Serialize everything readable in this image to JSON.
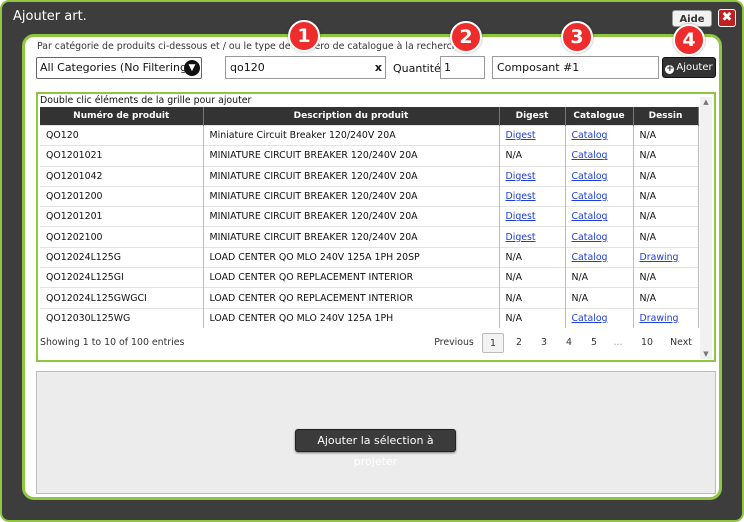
{
  "window": {
    "title": "Ajouter art.",
    "help_label": "Aide",
    "close_label": "✖"
  },
  "instruction": "Par catégorie de produits ci-dessous et / ou le type de numéro de catalogue à la recherche",
  "badges": [
    "1",
    "2",
    "3",
    "4"
  ],
  "colors": {
    "accent": "#8ec63f",
    "badge": "#ee2c2c",
    "dark": "#3d3d3d",
    "link": "#1f3fdd"
  },
  "filters": {
    "category": {
      "selected": "All Categories (No Filtering)"
    },
    "search": {
      "value": "qo120",
      "clear_label": "x"
    },
    "quantity": {
      "label": "Quantité:",
      "value": "1"
    },
    "component": {
      "value": "Composant #1"
    },
    "add_label": "Ajouter"
  },
  "grid": {
    "caption": "Double clic éléments de la grille pour ajouter",
    "columns": [
      "Numéro de produit",
      "Description du produit",
      "Digest",
      "Catalogue",
      "Dessin"
    ],
    "rows": [
      {
        "product": "QO120",
        "description": "Miniature Circuit Breaker 120/240V 20A",
        "digest": "Digest",
        "catalog": "Catalog",
        "drawing": "N/A"
      },
      {
        "product": "QO1201021",
        "description": "MINIATURE CIRCUIT BREAKER 120/240V 20A",
        "digest": "N/A",
        "catalog": "Catalog",
        "drawing": "N/A"
      },
      {
        "product": "QO1201042",
        "description": "MINIATURE CIRCUIT BREAKER 120/240V 20A",
        "digest": "Digest",
        "catalog": "Catalog",
        "drawing": "N/A"
      },
      {
        "product": "QO1201200",
        "description": "MINIATURE CIRCUIT BREAKER 120/240V 20A",
        "digest": "Digest",
        "catalog": "Catalog",
        "drawing": "N/A"
      },
      {
        "product": "QO1201201",
        "description": "MINIATURE CIRCUIT BREAKER 120/240V 20A",
        "digest": "Digest",
        "catalog": "Catalog",
        "drawing": "N/A"
      },
      {
        "product": "QO1202100",
        "description": "MINIATURE CIRCUIT BREAKER 120/240V 20A",
        "digest": "Digest",
        "catalog": "Catalog",
        "drawing": "N/A"
      },
      {
        "product": "QO12024L125G",
        "description": "LOAD CENTER QO MLO 240V 125A 1PH 20SP",
        "digest": "N/A",
        "catalog": "Catalog",
        "drawing": "Drawing"
      },
      {
        "product": "QO12024L125GI",
        "description": "LOAD CENTER QO REPLACEMENT INTERIOR",
        "digest": "N/A",
        "catalog": "N/A",
        "drawing": "N/A"
      },
      {
        "product": "QO12024L125GWGCI",
        "description": "LOAD CENTER QO REPLACEMENT INTERIOR",
        "digest": "N/A",
        "catalog": "N/A",
        "drawing": "N/A"
      },
      {
        "product": "QO12030L125WG",
        "description": "LOAD CENTER QO MLO 240V 125A 1PH",
        "digest": "N/A",
        "catalog": "Catalog",
        "drawing": "Drawing"
      }
    ],
    "showing": "Showing 1 to 10 of 100 entries",
    "pagination": {
      "previous": "Previous",
      "pages": [
        "1",
        "2",
        "3",
        "4",
        "5",
        "...",
        "10"
      ],
      "current": "1",
      "next": "Next"
    }
  },
  "project_button": "Ajouter la sélection à projeter"
}
